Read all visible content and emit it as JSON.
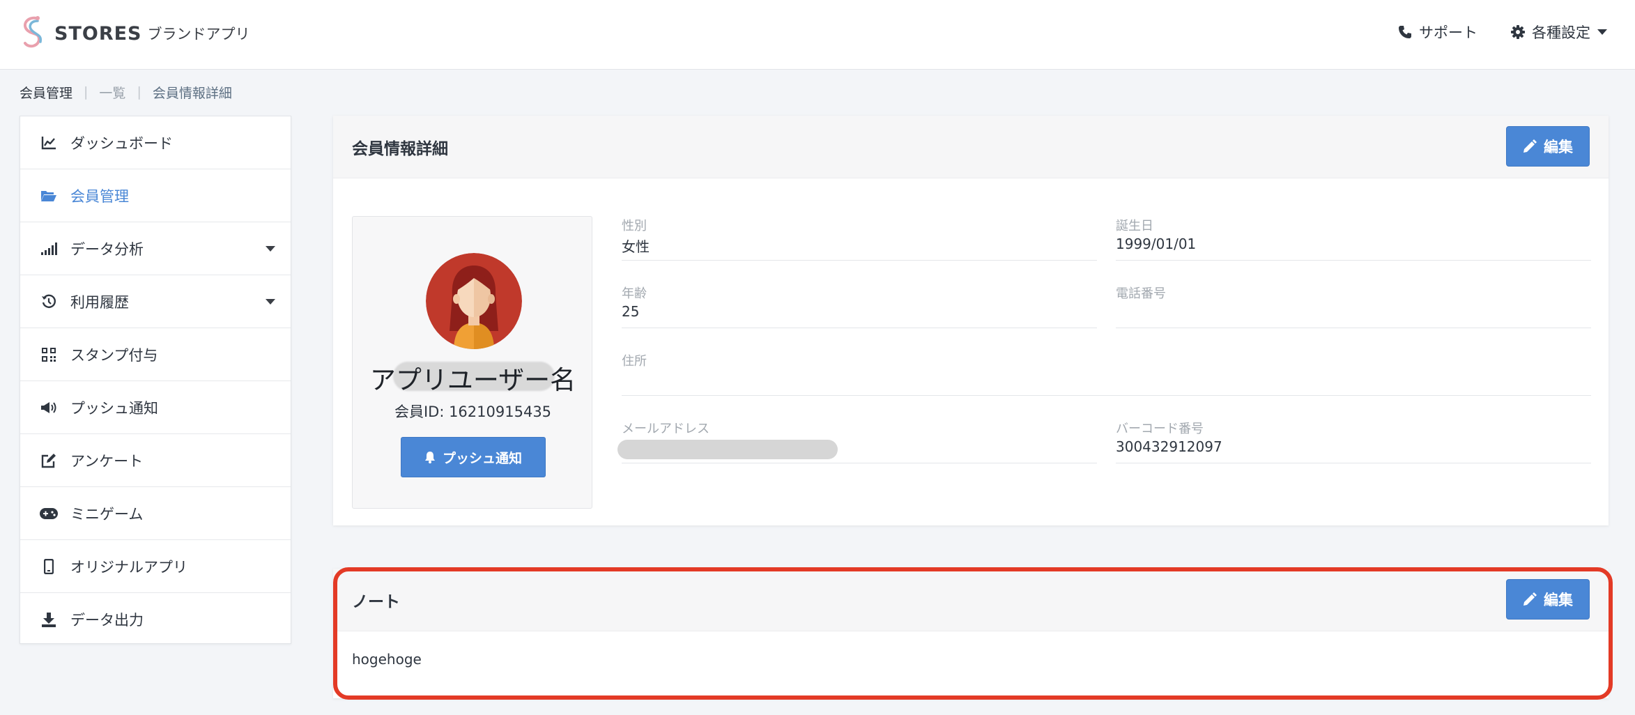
{
  "header": {
    "logo_word": "STORES",
    "logo_sub": "ブランドアプリ",
    "support_label": "サポート",
    "settings_label": "各種設定"
  },
  "breadcrumb": [
    "会員管理",
    "一覧",
    "会員情報詳細"
  ],
  "sidebar": {
    "items": [
      {
        "label": "ダッシュボード",
        "icon": "chart-line-icon"
      },
      {
        "label": "会員管理",
        "icon": "folder-open-icon",
        "active": true
      },
      {
        "label": "データ分析",
        "icon": "signal-icon",
        "dropdown": true
      },
      {
        "label": "利用履歴",
        "icon": "history-icon",
        "dropdown": true
      },
      {
        "label": "スタンプ付与",
        "icon": "qrcode-icon"
      },
      {
        "label": "プッシュ通知",
        "icon": "bullhorn-icon"
      },
      {
        "label": "アンケート",
        "icon": "edit-icon"
      },
      {
        "label": "ミニゲーム",
        "icon": "gamepad-icon"
      },
      {
        "label": "オリジナルアプリ",
        "icon": "mobile-icon"
      },
      {
        "label": "データ出力",
        "icon": "download-icon"
      }
    ]
  },
  "detail": {
    "title": "会員情報詳細",
    "edit_label": "編集",
    "user_name": "アプリユーザー名",
    "member_id": "会員ID: 16210915435",
    "push_label": "プッシュ通知",
    "fields": {
      "gender": {
        "label": "性別",
        "value": "女性"
      },
      "birthday": {
        "label": "誕生日",
        "value": "1999/01/01"
      },
      "age": {
        "label": "年齢",
        "value": "25"
      },
      "phone": {
        "label": "電話番号",
        "value": ""
      },
      "address": {
        "label": "住所",
        "value": ""
      },
      "email": {
        "label": "メールアドレス",
        "value": ""
      },
      "barcode": {
        "label": "バーコード番号",
        "value": "300432912097"
      }
    }
  },
  "note": {
    "title": "ノート",
    "edit_label": "編集",
    "body": "hogehoge"
  },
  "colors": {
    "primary": "#4a87d6",
    "highlight": "#e33a26",
    "background": "#f3f5f8"
  }
}
